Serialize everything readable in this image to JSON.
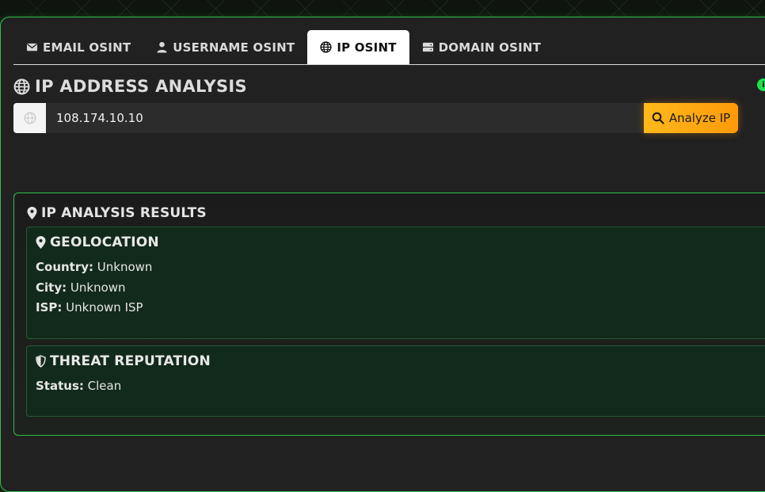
{
  "tabs": [
    {
      "label": "EMAIL OSINT",
      "icon": "envelope-icon",
      "active": false
    },
    {
      "label": "USERNAME OSINT",
      "icon": "user-icon",
      "active": false
    },
    {
      "label": "IP OSINT",
      "icon": "globe-icon",
      "active": true
    },
    {
      "label": "DOMAIN OSINT",
      "icon": "server-icon",
      "active": false
    }
  ],
  "section": {
    "title": "IP ADDRESS ANALYSIS",
    "icon": "globe-icon",
    "badge": "i"
  },
  "search": {
    "value": "108.174.10.10",
    "button_label": "Analyze IP",
    "button_icon": "search-icon"
  },
  "results": {
    "title": "IP ANALYSIS RESULTS",
    "geolocation": {
      "title": "GEOLOCATION",
      "country_label": "Country:",
      "country_value": "Unknown",
      "city_label": "City:",
      "city_value": "Unknown",
      "isp_label": "ISP:",
      "isp_value": "Unknown ISP"
    },
    "threat": {
      "title": "THREAT REPUTATION",
      "status_label": "Status:",
      "status_value": "Clean"
    }
  },
  "colors": {
    "accent_green": "#2fbf4a",
    "button_orange": "#ffa412",
    "card_bg": "#122a1c"
  }
}
